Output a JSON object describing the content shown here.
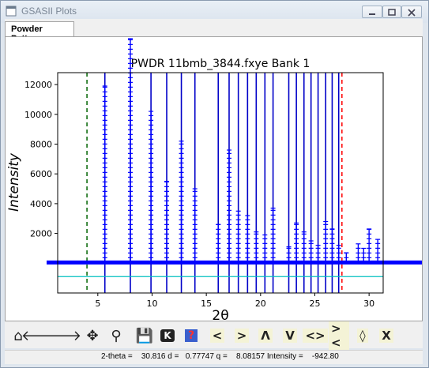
{
  "window": {
    "title": "GSASII Plots"
  },
  "tabs": [
    {
      "label": "Powder Patterns"
    }
  ],
  "chart_data": {
    "type": "line",
    "title": "PWDR 11bmb_3844.fxye Bank 1",
    "xlabel": "2θ",
    "ylabel": "Intensity",
    "xlim": [
      1.3,
      31.3
    ],
    "ylim": [
      -2000,
      12800
    ],
    "xticks": [
      5,
      10,
      15,
      20,
      25,
      30
    ],
    "yticks": [
      2000,
      4000,
      6000,
      8000,
      10000,
      12000
    ],
    "xtick_labels": [
      "5",
      "10",
      "15",
      "20",
      "25",
      "30"
    ],
    "ytick_labels": [
      "2000",
      "4000",
      "6000",
      "8000",
      "10000",
      "12000"
    ],
    "limit_lines": [
      {
        "x": 4.0,
        "color": "#006400",
        "style": "dashed"
      },
      {
        "x": 27.5,
        "color": "#ff0000",
        "style": "dashed"
      }
    ],
    "reflection_positions": [
      5.65,
      8.0,
      9.9,
      11.35,
      12.7,
      13.95,
      16.1,
      17.1,
      17.95,
      18.8,
      19.6,
      20.4,
      21.15,
      22.6,
      23.3,
      24.0,
      24.65,
      25.3,
      26.0,
      26.6,
      27.2
    ],
    "observed_peaks": [
      {
        "x": 5.65,
        "y": 11900
      },
      {
        "x": 8.0,
        "y": 15800
      },
      {
        "x": 9.9,
        "y": 10200
      },
      {
        "x": 11.35,
        "y": 5500
      },
      {
        "x": 12.7,
        "y": 8200
      },
      {
        "x": 13.95,
        "y": 5000
      },
      {
        "x": 16.1,
        "y": 2600
      },
      {
        "x": 17.1,
        "y": 7600
      },
      {
        "x": 17.95,
        "y": 3500
      },
      {
        "x": 18.8,
        "y": 3200
      },
      {
        "x": 19.6,
        "y": 2100
      },
      {
        "x": 20.4,
        "y": 1900
      },
      {
        "x": 21.15,
        "y": 3700
      },
      {
        "x": 22.6,
        "y": 1100
      },
      {
        "x": 23.3,
        "y": 2700
      },
      {
        "x": 24.0,
        "y": 2100
      },
      {
        "x": 24.65,
        "y": 1500
      },
      {
        "x": 25.3,
        "y": 1200
      },
      {
        "x": 26.0,
        "y": 2800
      },
      {
        "x": 26.6,
        "y": 2300
      },
      {
        "x": 27.2,
        "y": 1200
      },
      {
        "x": 27.9,
        "y": 700
      },
      {
        "x": 29.0,
        "y": 1300
      },
      {
        "x": 29.5,
        "y": 1000
      },
      {
        "x": 30.0,
        "y": 2300
      },
      {
        "x": 30.8,
        "y": 1600
      }
    ],
    "background_level": 50,
    "difference_offset": -300,
    "series_colors": {
      "observed": "#0000ff",
      "reflections": "#0000c8",
      "background": "#ff0000",
      "difference": "#00bfbf"
    }
  },
  "toolbar": {
    "items": [
      {
        "name": "home-icon",
        "glyph": "⌂"
      },
      {
        "name": "back-arrow-icon",
        "glyph": "🡐"
      },
      {
        "name": "forward-arrow-icon",
        "glyph": "🡒"
      },
      {
        "name": "pan-icon",
        "glyph": "✥"
      },
      {
        "name": "zoom-icon",
        "glyph": "⚲"
      },
      {
        "name": "save-icon",
        "glyph": "💾"
      },
      {
        "name": "k-icon",
        "glyph": "K"
      },
      {
        "name": "help-icon",
        "glyph": "?"
      },
      {
        "name": "shift-left-icon",
        "glyph": "<"
      },
      {
        "name": "shift-right-icon",
        "glyph": ">"
      },
      {
        "name": "shift-up-icon",
        "glyph": "Λ"
      },
      {
        "name": "shift-down-icon",
        "glyph": "V"
      },
      {
        "name": "expand-x-icon",
        "glyph": "<>"
      },
      {
        "name": "contract-x-icon",
        "glyph": "><"
      },
      {
        "name": "expand-y-icon",
        "glyph": "◊"
      },
      {
        "name": "contract-y-icon",
        "glyph": "X"
      }
    ]
  },
  "status": {
    "text": "2-theta =    30.816 d =   0.77747 q =    8.08157 Intensity =    -942.80"
  }
}
